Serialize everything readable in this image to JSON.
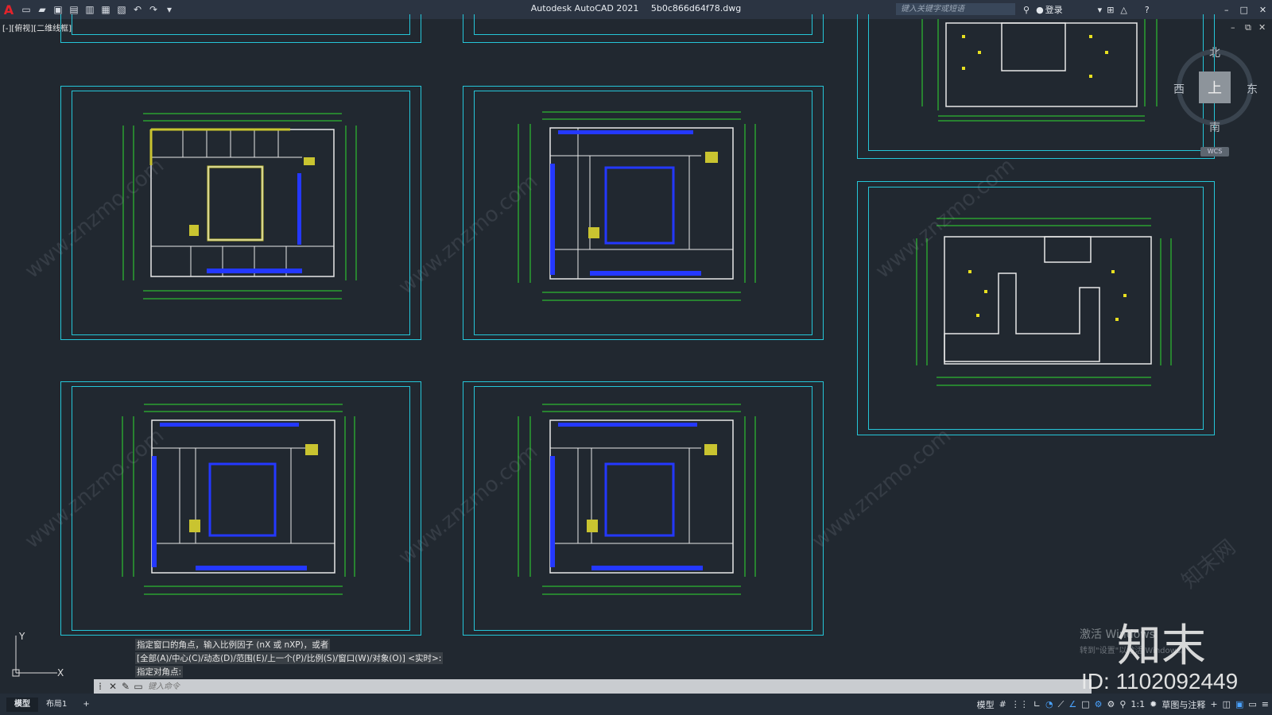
{
  "titlebar": {
    "app_letter": "A",
    "app_name": "Autodesk AutoCAD 2021",
    "file_name": "5b0c866d64f78.dwg",
    "search_placeholder": "键入关键字或短语",
    "login": "登录"
  },
  "viewport": {
    "label": "[-][俯视][二维线框]",
    "viewcube": {
      "top": "上",
      "north": "北",
      "south": "南",
      "east": "东",
      "west": "西",
      "wcs": "WCS"
    }
  },
  "command": {
    "history": [
      "指定窗口的角点，输入比例因子 (nX 或 nXP)，或者",
      "[全部(A)/中心(C)/动态(D)/范围(E)/上一个(P)/比例(S)/窗口(W)/对象(O)] <实时>:",
      "指定对角点:"
    ],
    "input_placeholder": "键入命令"
  },
  "status": {
    "tabs": [
      "模型",
      "布局1"
    ],
    "model_label": "模型",
    "scale": "1:1",
    "workspace": "草图与注释"
  },
  "watermark": {
    "activate_line1": "激活 Windows",
    "activate_line2": "转到\"设置\"以激活 Windows。",
    "brand": "知末",
    "id_text": "ID: 1102092449",
    "site": "www.znzmo.com",
    "site_cn": "知末网"
  },
  "colors": {
    "background": "#212830",
    "frame": "#25c6d8",
    "wall": "#e8e8e8",
    "dimension": "#2fdc2f",
    "column": "#2438ff",
    "stair": "#e8e020"
  }
}
